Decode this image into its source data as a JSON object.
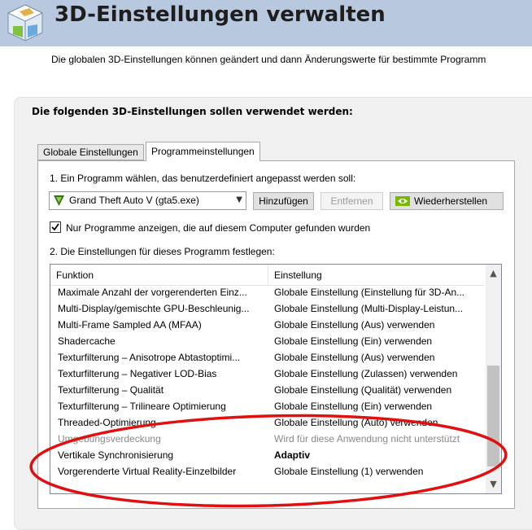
{
  "header": {
    "title": "3D-Einstellungen verwalten",
    "subtitle": "Die globalen 3D-Einstellungen können geändert und dann Änderungswerte für bestimmte Programm"
  },
  "section": {
    "title": "Die folgenden 3D-Einstellungen sollen verwendet werden:"
  },
  "tabs": [
    {
      "label": "Globale Einstellungen",
      "active": false
    },
    {
      "label": "Programmeinstellungen",
      "active": true
    }
  ],
  "step1": {
    "label": "1. Ein Programm wählen, das benutzerdefiniert angepasst werden soll:",
    "program_selected": "Grand Theft Auto V (gta5.exe)",
    "add_button": "Hinzufügen",
    "remove_button": "Entfernen",
    "restore_button": "Wiederherstellen",
    "checkbox_label": "Nur Programme anzeigen, die auf diesem Computer gefunden wurden",
    "checkbox_checked": true
  },
  "step2": {
    "label": "2. Die Einstellungen für dieses Programm festlegen:"
  },
  "table": {
    "columns": [
      "Funktion",
      "Einstellung"
    ],
    "rows": [
      {
        "function": "Maximale Anzahl der vorgerenderten Einz...",
        "setting": "Globale Einstellung (Einstellung für 3D-An...",
        "state": "normal"
      },
      {
        "function": "Multi-Display/gemischte GPU-Beschleunig...",
        "setting": "Globale Einstellung (Multi-Display-Leistun...",
        "state": "normal"
      },
      {
        "function": "Multi-Frame Sampled AA (MFAA)",
        "setting": "Globale Einstellung (Aus) verwenden",
        "state": "normal"
      },
      {
        "function": "Shadercache",
        "setting": "Globale Einstellung (Ein) verwenden",
        "state": "normal"
      },
      {
        "function": "Texturfilterung – Anisotrope Abtastoptimi...",
        "setting": "Globale Einstellung (Aus) verwenden",
        "state": "normal"
      },
      {
        "function": "Texturfilterung – Negativer LOD-Bias",
        "setting": "Globale Einstellung (Zulassen) verwenden",
        "state": "normal"
      },
      {
        "function": "Texturfilterung – Qualität",
        "setting": "Globale Einstellung (Qualität) verwenden",
        "state": "normal"
      },
      {
        "function": "Texturfilterung – Trilineare Optimierung",
        "setting": "Globale Einstellung (Ein) verwenden",
        "state": "normal"
      },
      {
        "function": "Threaded-Optimierung",
        "setting": "Globale Einstellung (Auto) verwenden",
        "state": "normal"
      },
      {
        "function": "Umgebungsverdeckung",
        "setting": "Wird für diese Anwendung nicht unterstützt",
        "state": "disabled"
      },
      {
        "function": "Vertikale Synchronisierung",
        "setting": "Adaptiv",
        "state": "bold"
      },
      {
        "function": "Vorgerenderte Virtual Reality-Einzelbilder",
        "setting": "Globale Einstellung (1) verwenden",
        "state": "normal"
      }
    ]
  },
  "colors": {
    "header_bg": "#b8c8de",
    "section_bg": "#f0f0f0",
    "nvidia_green": "#76b900",
    "annotation_ellipse": "#e01010"
  },
  "icons": {
    "header": "3d-cube-icon",
    "program": "gta-v-icon",
    "restore": "nvidia-logo-icon"
  }
}
